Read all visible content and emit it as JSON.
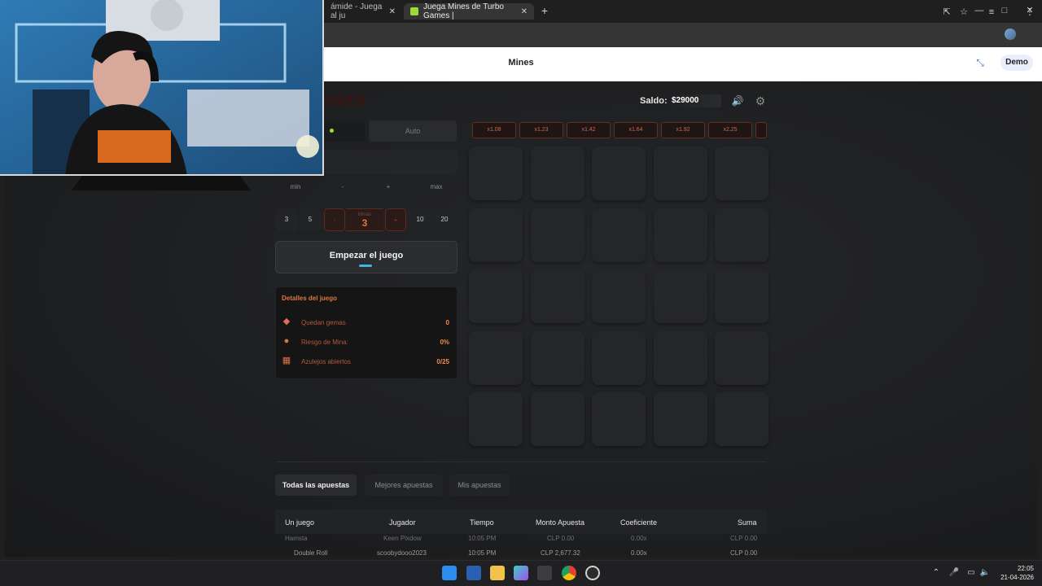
{
  "browser": {
    "tabs": [
      {
        "title": "ámide - Juega al ju",
        "active": false
      },
      {
        "title": "Juega Mines de Turbo Games |",
        "active": true
      }
    ],
    "new_tab": "+",
    "window_controls": {
      "minimize": "—",
      "maximize": "□",
      "close": "✕"
    }
  },
  "header": {
    "title": "Mines",
    "collapse_icon": "collapse-icon",
    "demo_label": "Demo"
  },
  "game": {
    "logo": "INES",
    "balance": {
      "label": "Saldo:",
      "value": "$29000"
    },
    "mode": {
      "auto_label": "Auto"
    },
    "bet_buttons": [
      "min",
      "-",
      "+",
      "max"
    ],
    "mines": {
      "quick": [
        "3",
        "5",
        "10",
        "20"
      ],
      "decrement": "-",
      "increment": "+",
      "label": "Minas",
      "value": "3"
    },
    "start_button": "Empezar el juego",
    "details": {
      "title": "Detalles del juego",
      "rows": [
        {
          "icon": "gem-icon",
          "label": "Quedan gemas",
          "value": "0"
        },
        {
          "icon": "bomb-icon",
          "label": "Riesgo de Mina:",
          "value": "0%"
        },
        {
          "icon": "tiles-icon",
          "label": "Azulejos abiertos",
          "value": "0/25"
        }
      ]
    },
    "multipliers": [
      "x1.08",
      "x1.23",
      "x1.42",
      "x1.64",
      "x1.92",
      "x2.25"
    ],
    "grid": {
      "rows": 5,
      "cols": 5
    },
    "accent_color": "#e0763c"
  },
  "bets": {
    "tabs": [
      "Todas las apuestas",
      "Mejores apuestas",
      "Mis apuestas"
    ],
    "columns": [
      "Un juego",
      "Jugador",
      "Tiempo",
      "Monto Apuesta",
      "Coeficiente",
      "Suma"
    ],
    "rows": [
      {
        "game": "Hamsta",
        "player": "Keen Pixdow",
        "time": "10:05 PM",
        "amount": "CLP 0.00",
        "coef": "0.00x",
        "sum": "CLP 0.00"
      },
      {
        "game": "Double Roll",
        "player": "scoobydooo2023",
        "time": "10:05 PM",
        "amount": "CLP 2,677.32",
        "coef": "0.00x",
        "sum": "CLP 0.00"
      }
    ]
  },
  "taskbar": {
    "clock_time": "22:05",
    "clock_date": "21-04-2026"
  }
}
